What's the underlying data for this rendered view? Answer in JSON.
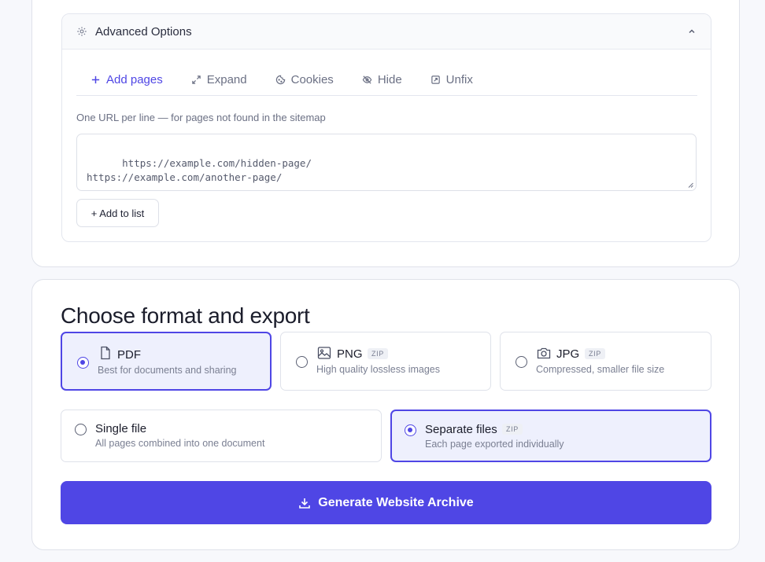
{
  "advanced": {
    "title": "Advanced Options",
    "tabs": [
      {
        "label": "Add pages",
        "icon": "plus-icon",
        "active": true
      },
      {
        "label": "Expand",
        "icon": "expand-icon",
        "active": false
      },
      {
        "label": "Cookies",
        "icon": "cookie-icon",
        "active": false
      },
      {
        "label": "Hide",
        "icon": "eye-off-icon",
        "active": false
      },
      {
        "label": "Unfix",
        "icon": "unfix-icon",
        "active": false
      }
    ],
    "hint": "One URL per line — for pages not found in the sitemap",
    "urls_value": "https://example.com/hidden-page/\nhttps://example.com/another-page/",
    "add_button": "+ Add to list"
  },
  "export": {
    "heading": "Choose format and export",
    "formats": [
      {
        "name": "PDF",
        "desc": "Best for documents and sharing",
        "badge": "",
        "icon": "file-icon",
        "selected": true
      },
      {
        "name": "PNG",
        "desc": "High quality lossless images",
        "badge": "ZIP",
        "icon": "image-icon",
        "selected": false
      },
      {
        "name": "JPG",
        "desc": "Compressed, smaller file size",
        "badge": "ZIP",
        "icon": "camera-icon",
        "selected": false
      }
    ],
    "modes": [
      {
        "name": "Single file",
        "desc": "All pages combined into one document",
        "badge": "",
        "selected": false
      },
      {
        "name": "Separate files",
        "desc": "Each page exported individually",
        "badge": "ZIP",
        "selected": true
      }
    ],
    "generate_label": "Generate Website Archive"
  },
  "colors": {
    "accent": "#4f46e5",
    "selected_bg": "#eef0fd"
  }
}
